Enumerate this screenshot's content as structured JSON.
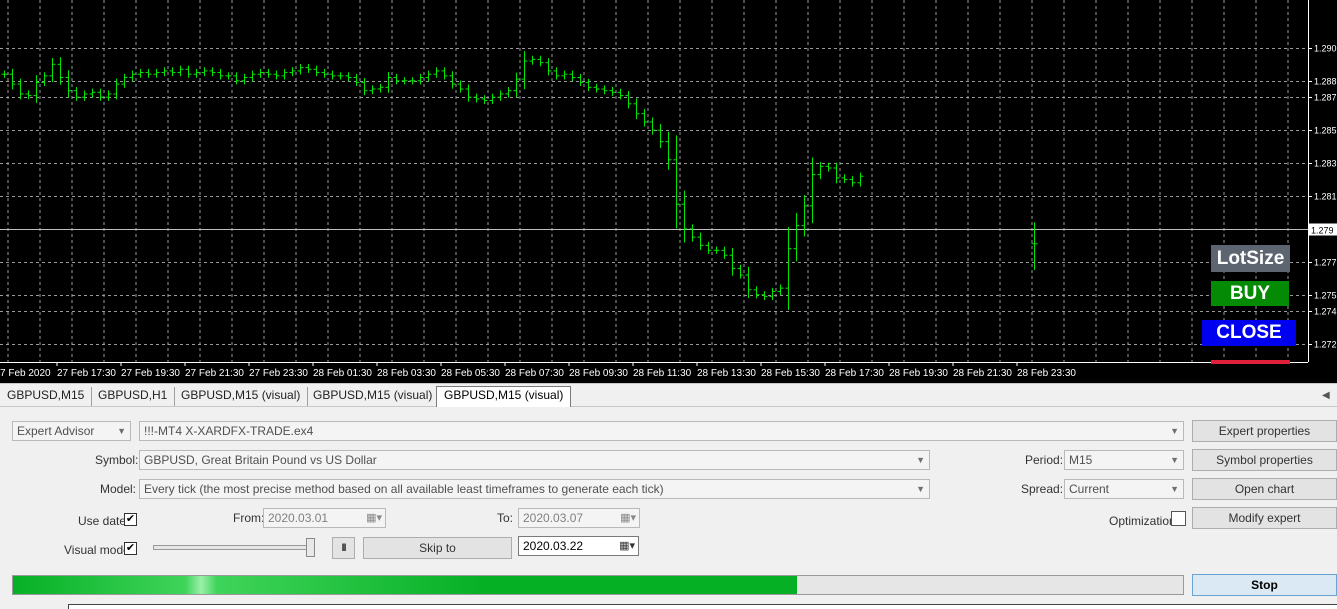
{
  "chart_data": {
    "type": "ohlc",
    "symbol_timeframe": "GBPUSD,M15",
    "price_axis_ticks": [
      "1.290",
      "1.288",
      "1.287",
      "1.285",
      "1.283",
      "1.281",
      "1.279",
      "1.277",
      "1.275",
      "1.274",
      "1.272"
    ],
    "current_price_label": "1.279",
    "time_axis_ticks": [
      "7 Feb 2020",
      "27 Feb 17:30",
      "27 Feb 19:30",
      "27 Feb 21:30",
      "27 Feb 23:30",
      "28 Feb 01:30",
      "28 Feb 03:30",
      "28 Feb 05:30",
      "28 Feb 07:30",
      "28 Feb 09:30",
      "28 Feb 11:30",
      "28 Feb 13:30",
      "28 Feb 15:30",
      "28 Feb 17:30",
      "28 Feb 19:30",
      "28 Feb 21:30",
      "28 Feb 23:30"
    ],
    "ylim": [
      1.2714,
      1.2923
    ],
    "grid": true,
    "bar_color": "#00e600",
    "background": "#000000",
    "closes": [
      1.2884,
      1.2878,
      1.2872,
      1.2871,
      1.2879,
      1.2883,
      1.289,
      1.2882,
      1.2874,
      1.287,
      1.2872,
      1.2873,
      1.287,
      1.2872,
      1.2878,
      1.2882,
      1.2884,
      1.2885,
      1.2884,
      1.2885,
      1.2886,
      1.2885,
      1.2887,
      1.2884,
      1.2885,
      1.2886,
      1.2885,
      1.2883,
      1.2883,
      1.288,
      1.2882,
      1.2884,
      1.2885,
      1.2884,
      1.2883,
      1.2885,
      1.2886,
      1.2888,
      1.2887,
      1.2885,
      1.2884,
      1.2883,
      1.2883,
      1.2882,
      1.2879,
      1.2874,
      1.2875,
      1.2876,
      1.2882,
      1.288,
      1.288,
      1.288,
      1.2882,
      1.2884,
      1.2886,
      1.2883,
      1.2878,
      1.2875,
      1.287,
      1.2869,
      1.2868,
      1.287,
      1.2872,
      1.2874,
      1.2881,
      1.2892,
      1.2893,
      1.2891,
      1.2886,
      1.2883,
      1.2884,
      1.2882,
      1.2879,
      1.2876,
      1.2875,
      1.2874,
      1.2873,
      1.2871,
      1.2866,
      1.286,
      1.2855,
      1.285,
      1.2843,
      1.2832,
      1.2805,
      1.279,
      1.2785,
      1.278,
      1.2777,
      1.2777,
      1.2774,
      1.2766,
      1.2762,
      1.2753,
      1.275,
      1.2749,
      1.2752,
      1.2754,
      1.2778,
      1.2792,
      1.2804,
      1.2823,
      1.2828,
      1.2827,
      1.2821,
      1.282,
      1.2818,
      1.2822
    ],
    "last_bar": {
      "open": 1.2781,
      "close": 1.2781,
      "high": 1.2794,
      "low": 1.2765
    }
  },
  "overlay_buttons": {
    "lotsize": "LotSize",
    "buy": "BUY",
    "close": "CLOSE"
  },
  "tabs": [
    {
      "label": "GBPUSD,M15",
      "active": false
    },
    {
      "label": "GBPUSD,H1",
      "active": false
    },
    {
      "label": "GBPUSD,M15 (visual)",
      "active": false
    },
    {
      "label": "GBPUSD,M15 (visual)",
      "active": false
    },
    {
      "label": "GBPUSD,M15 (visual)",
      "active": true
    }
  ],
  "tester": {
    "type_value": "Expert Advisor",
    "expert_file": "!!!-MT4 X-XARDFX-TRADE.ex4",
    "symbol_label": "Symbol:",
    "symbol_value": "GBPUSD, Great Britain Pound vs US Dollar",
    "model_label": "Model:",
    "model_value": "Every tick (the most precise method based on all available least timeframes to generate each tick)",
    "period_label": "Period:",
    "period_value": "M15",
    "spread_label": "Spread:",
    "spread_value": "Current",
    "use_date_label": "Use date",
    "use_date_checked": "✔",
    "from_label": "From:",
    "from_value": "2020.03.01",
    "to_label": "To:",
    "to_value": "2020.03.07",
    "optimization_label": "Optimization",
    "visual_mode_label": "Visual mode",
    "visual_mode_checked": "✔",
    "pause_symbol": "II",
    "skip_to_label": "Skip to",
    "skip_to_date": "2020.03.22",
    "buttons": {
      "expert_properties": "Expert properties",
      "symbol_properties": "Symbol properties",
      "open_chart": "Open chart",
      "modify_expert": "Modify expert",
      "stop": "Stop"
    },
    "progress": 0.67
  }
}
